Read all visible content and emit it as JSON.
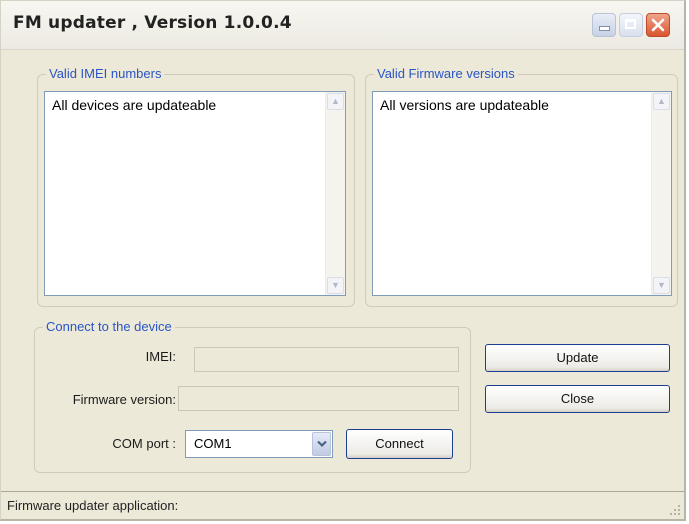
{
  "window": {
    "title": "FM updater , Version 1.0.0.4"
  },
  "imei_group": {
    "legend": "Valid IMEI numbers",
    "items": [
      "All devices are updateable"
    ]
  },
  "firmware_group": {
    "legend": "Valid Firmware versions",
    "items": [
      "All versions are updateable"
    ]
  },
  "connect_group": {
    "legend": "Connect to the device",
    "imei_label": "IMEI:",
    "imei_value": "",
    "firmware_label": "Firmware version:",
    "firmware_value": "",
    "com_label": "COM port :",
    "com_selected": "COM1",
    "connect_label": "Connect"
  },
  "buttons": {
    "update_label": "Update",
    "close_label": "Close"
  },
  "status": {
    "text": "Firmware updater application:"
  },
  "icons": [
    "minimize-icon",
    "maximize-icon",
    "close-icon",
    "scroll-up-icon",
    "scroll-down-icon",
    "chevron-down-icon",
    "size-grip-icon"
  ],
  "colors": {
    "accent_text": "#2a55c4",
    "window_bg": "#ece9d8",
    "close_button": "#d9542f",
    "button_border": "#1c3f94"
  }
}
